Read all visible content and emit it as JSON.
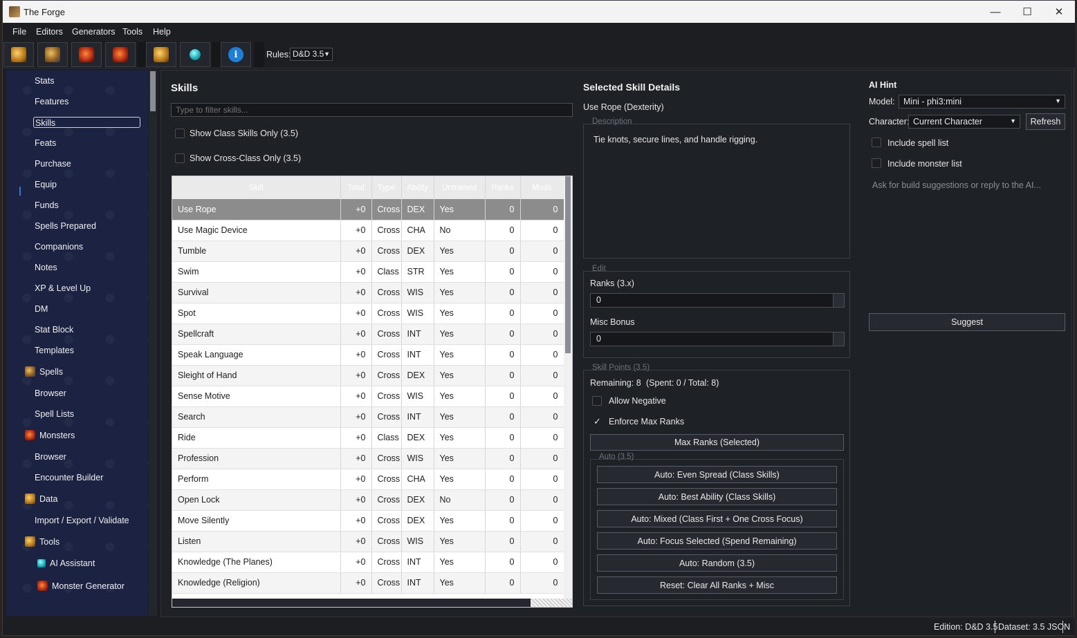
{
  "window": {
    "title": "The Forge",
    "minimize": "—",
    "maximize": "☐",
    "close": "✕"
  },
  "menu": [
    "File",
    "Editors",
    "Generators",
    "Tools",
    "Help"
  ],
  "toolbar": {
    "info_glyph": "i",
    "rules_label": "Rules:",
    "rules_value": "D&D 3.5",
    "caret": "▼"
  },
  "sidebar": {
    "items": [
      "Stats",
      "Features",
      "Skills",
      "Feats",
      "Purchase",
      "Equip",
      "Funds",
      "Spells Prepared",
      "Companions",
      "Notes",
      "XP & Level Up",
      "DM",
      "Stat Block",
      "Templates"
    ],
    "groups": {
      "spells": {
        "label": "Spells",
        "children": [
          "Browser",
          "Spell Lists"
        ]
      },
      "monsters": {
        "label": "Monsters",
        "children": [
          "Browser",
          "Encounter Builder"
        ]
      },
      "data": {
        "label": "Data",
        "children": [
          "Import / Export / Validate"
        ]
      },
      "tools": {
        "label": "Tools",
        "children": [
          "AI Assistant",
          "Monster Generator"
        ]
      }
    }
  },
  "skills_panel": {
    "title": "Skills",
    "filter_placeholder": "Type to filter skills...",
    "show_class_only": "Show Class Skills Only (3.5)",
    "show_cross_only": "Show Cross-Class Only (3.5)",
    "columns": [
      "Skill",
      "Total",
      "Type",
      "Ability",
      "Untrained",
      "Ranks",
      "Mods"
    ],
    "rows": [
      [
        "Use Rope",
        "+0",
        "Cross",
        "DEX",
        "Yes",
        "0",
        "0"
      ],
      [
        "Use Magic Device",
        "+0",
        "Cross",
        "CHA",
        "No",
        "0",
        "0"
      ],
      [
        "Tumble",
        "+0",
        "Cross",
        "DEX",
        "Yes",
        "0",
        "0"
      ],
      [
        "Swim",
        "+0",
        "Class",
        "STR",
        "Yes",
        "0",
        "0"
      ],
      [
        "Survival",
        "+0",
        "Cross",
        "WIS",
        "Yes",
        "0",
        "0"
      ],
      [
        "Spot",
        "+0",
        "Cross",
        "WIS",
        "Yes",
        "0",
        "0"
      ],
      [
        "Spellcraft",
        "+0",
        "Cross",
        "INT",
        "Yes",
        "0",
        "0"
      ],
      [
        "Speak Language",
        "+0",
        "Cross",
        "INT",
        "Yes",
        "0",
        "0"
      ],
      [
        "Sleight of Hand",
        "+0",
        "Cross",
        "DEX",
        "Yes",
        "0",
        "0"
      ],
      [
        "Sense Motive",
        "+0",
        "Cross",
        "WIS",
        "Yes",
        "0",
        "0"
      ],
      [
        "Search",
        "+0",
        "Cross",
        "INT",
        "Yes",
        "0",
        "0"
      ],
      [
        "Ride",
        "+0",
        "Class",
        "DEX",
        "Yes",
        "0",
        "0"
      ],
      [
        "Profession",
        "+0",
        "Cross",
        "WIS",
        "Yes",
        "0",
        "0"
      ],
      [
        "Perform",
        "+0",
        "Cross",
        "CHA",
        "Yes",
        "0",
        "0"
      ],
      [
        "Open Lock",
        "+0",
        "Cross",
        "DEX",
        "No",
        "0",
        "0"
      ],
      [
        "Move Silently",
        "+0",
        "Cross",
        "DEX",
        "Yes",
        "0",
        "0"
      ],
      [
        "Listen",
        "+0",
        "Cross",
        "WIS",
        "Yes",
        "0",
        "0"
      ],
      [
        "Knowledge (The Planes)",
        "+0",
        "Cross",
        "INT",
        "Yes",
        "0",
        "0"
      ],
      [
        "Knowledge (Religion)",
        "+0",
        "Cross",
        "INT",
        "Yes",
        "0",
        "0"
      ]
    ]
  },
  "details": {
    "title": "Selected Skill Details",
    "selected_name": "Use Rope (Dexterity)",
    "description_title": "Description",
    "description": "Tie knots, secure lines, and handle rigging.",
    "edit_title": "Edit",
    "ranks_label": "Ranks (3.x)",
    "ranks_value": "0",
    "misc_label": "Misc Bonus",
    "misc_value": "0",
    "points_title": "Skill Points (3.5)",
    "remaining": "Remaining: 8",
    "spent": "(Spent: 0 / Total: 8)",
    "allow_negative": "Allow Negative",
    "enforce_max": "Enforce Max Ranks",
    "check_mark": "✓",
    "max_ranks_btn": "Max Ranks (Selected)",
    "auto_title": "Auto (3.5)",
    "auto_buttons": [
      "Auto: Even Spread (Class Skills)",
      "Auto: Best Ability (Class Skills)",
      "Auto: Mixed (Class First + One Cross Focus)",
      "Auto: Focus Selected (Spend Remaining)",
      "Auto: Random (3.5)",
      "Reset: Clear All Ranks + Misc"
    ]
  },
  "ai": {
    "title": "AI Hint",
    "model_label": "Model:",
    "model_value": "Mini - phi3:mini",
    "character_label": "Character:",
    "character_value": "Current Character",
    "refresh": "Refresh",
    "include_spells": "Include spell list",
    "include_monsters": "Include monster list",
    "hint_placeholder": "Ask for build suggestions or reply to the AI...",
    "suggest": "Suggest"
  },
  "status": {
    "edition": "Edition: D&D 3.5",
    "dataset": "Dataset: 3.5 JSON"
  }
}
